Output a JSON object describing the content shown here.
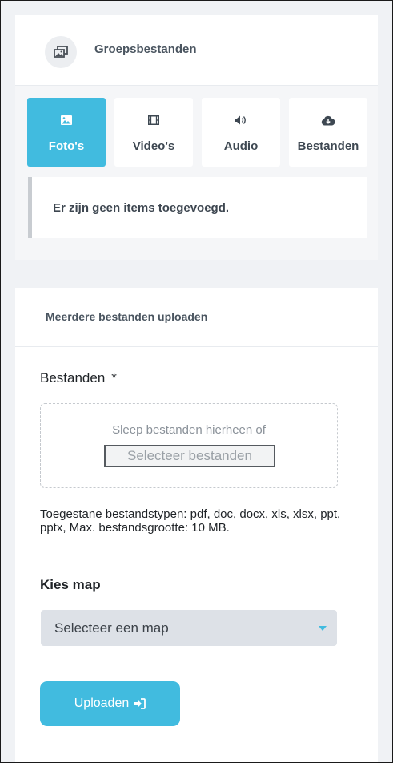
{
  "group_files": {
    "title": "Groepsbestanden",
    "icon": "images-icon"
  },
  "tabs": [
    {
      "label": "Foto's",
      "icon": "image-icon",
      "active": true
    },
    {
      "label": "Video's",
      "icon": "film-icon",
      "active": false
    },
    {
      "label": "Audio",
      "icon": "volume-icon",
      "active": false
    },
    {
      "label": "Bestanden",
      "icon": "cloud-download-icon",
      "active": false
    }
  ],
  "empty_message": "Er zijn geen items toegevoegd.",
  "upload": {
    "header": "Meerdere bestanden uploaden",
    "files_label": "Bestanden",
    "required_marker": "*",
    "dropzone_text": "Sleep bestanden hierheen of",
    "select_files_button": "Selecteer bestanden",
    "allowed_types_hint": "Toegestane bestandstypen: pdf, doc, docx, xls, xlsx, ppt, pptx, Max. bestandsgrootte: 10 MB.",
    "folder_label": "Kies map",
    "folder_select_value": "Selecteer een map",
    "submit_label": "Uploaden",
    "submit_icon": "sign-in-icon"
  },
  "colors": {
    "accent": "#41bbdf",
    "background": "#f0f2f5",
    "select_bg": "#dde1e7"
  }
}
